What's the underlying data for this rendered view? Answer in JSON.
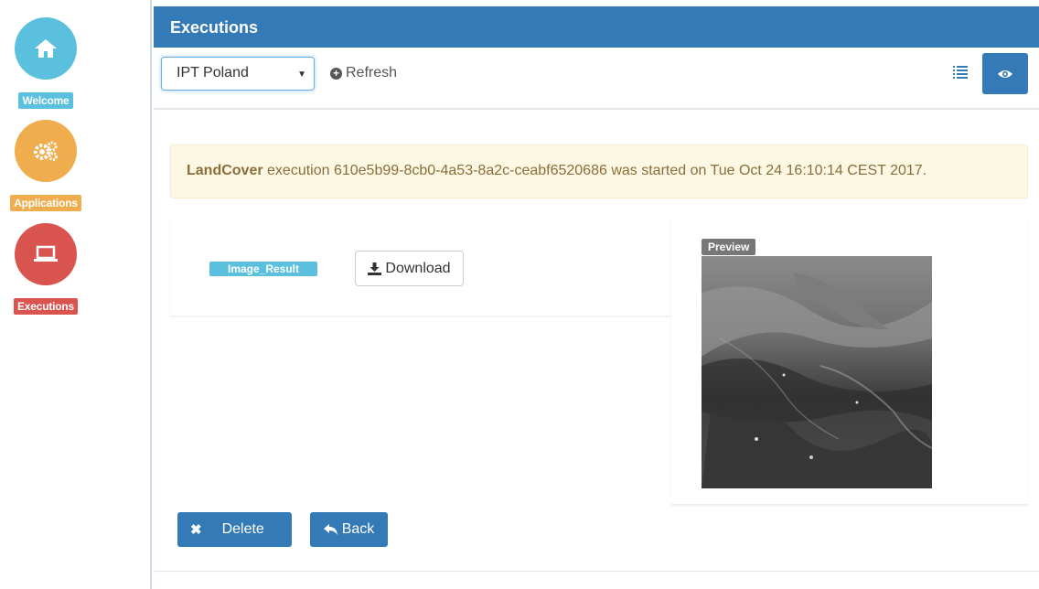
{
  "nav": {
    "welcome": "Welcome",
    "applications": "Applications",
    "executions": "Executions"
  },
  "header": {
    "title": "Executions"
  },
  "toolbar": {
    "selected_workspace": "IPT Poland",
    "refresh_label": "Refresh"
  },
  "alert": {
    "app_name": "LandCover",
    "message": " execution 610e5b99-8cb0-4a53-8a2c-ceabf6520686 was started on Tue Oct 24 16:10:14 CEST 2017."
  },
  "result": {
    "tag_label": "Image_Result",
    "download_label": "Download"
  },
  "preview": {
    "tag_label": "Preview"
  },
  "actions": {
    "delete_label": "Delete",
    "back_label": "Back"
  },
  "colors": {
    "primary": "#337ab7",
    "info": "#5bc0de",
    "warning": "#f0ad4e",
    "danger": "#d9534f"
  }
}
